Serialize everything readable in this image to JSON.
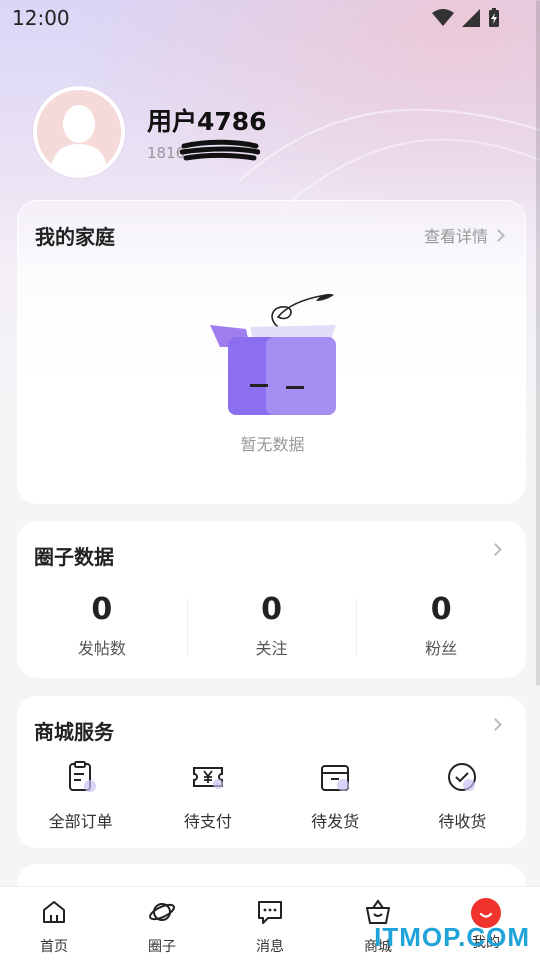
{
  "status_bar": {
    "time": "12:00"
  },
  "profile": {
    "username": "用户4786",
    "phone_partial": "1816"
  },
  "family": {
    "title": "我的家庭",
    "details_link": "查看详情",
    "empty_text": "暂无数据"
  },
  "circle": {
    "title": "圈子数据",
    "stats": [
      {
        "value": "0",
        "label": "发帖数"
      },
      {
        "value": "0",
        "label": "关注"
      },
      {
        "value": "0",
        "label": "粉丝"
      }
    ]
  },
  "mall": {
    "title": "商城服务",
    "services": [
      {
        "label": "全部订单",
        "icon": "clipboard-icon"
      },
      {
        "label": "待支付",
        "icon": "ticket-yen-icon"
      },
      {
        "label": "待发货",
        "icon": "box-icon"
      },
      {
        "label": "待收货",
        "icon": "check-circle-icon"
      }
    ]
  },
  "tabbar": {
    "tabs": [
      {
        "label": "首页",
        "icon": "home-icon"
      },
      {
        "label": "圈子",
        "icon": "planet-icon"
      },
      {
        "label": "消息",
        "icon": "message-icon"
      },
      {
        "label": "商城",
        "icon": "shopping-basket-icon"
      },
      {
        "label": "我的",
        "icon": "profile-active-icon"
      }
    ],
    "active_index": 4
  },
  "watermark": "ITMOP.COM",
  "colors": {
    "accent_red": "#f0342d",
    "illustration_purple": "#8b6ff0"
  }
}
